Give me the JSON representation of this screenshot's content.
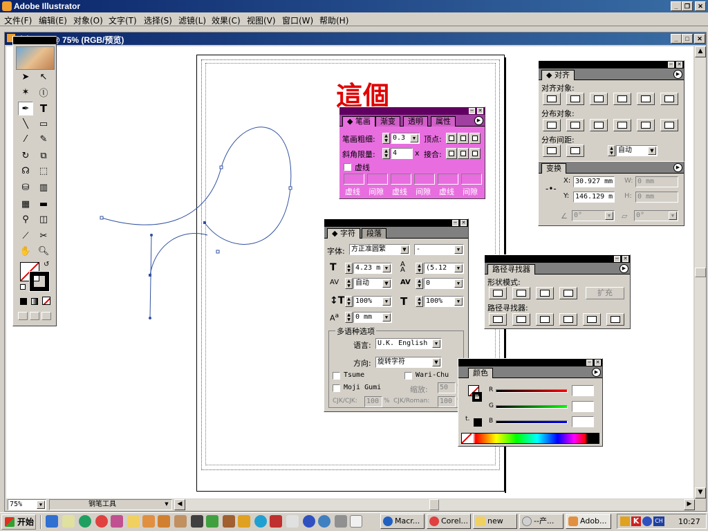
{
  "app": {
    "title": "Adobe Illustrator"
  },
  "menu": [
    "文件(F)",
    "编辑(E)",
    "对象(O)",
    "文字(T)",
    "选择(S)",
    "滤镜(L)",
    "效果(C)",
    "视图(V)",
    "窗口(W)",
    "帮助(H)"
  ],
  "document": {
    "title": "未标题-1 @ 75% (RGB/预览)"
  },
  "annotation": {
    "text": "這個",
    "color": "#e00000"
  },
  "stroke_panel": {
    "tabs": [
      "笔画",
      "渐变",
      "透明",
      "属性"
    ],
    "weight_label": "笔画粗细:",
    "weight_value": "0.3",
    "cap_label": "顶点:",
    "miter_label": "斜角限量:",
    "miter_value": "4",
    "miter_x": "x",
    "join_label": "接合:",
    "dashed_label": "虚线",
    "dash_labels": [
      "虚线",
      "间隙",
      "虚线",
      "间隙",
      "虚线",
      "间隙"
    ],
    "accent": "#e86ee0"
  },
  "character_panel": {
    "tabs": [
      "字符",
      "段落"
    ],
    "font_label": "字体:",
    "font_value": "方正准圆繁",
    "style_value": "-",
    "size_value": "4.23 m",
    "leading_value": "(5.12",
    "kerning_value": "自动",
    "tracking_value": "0",
    "vscale_value": "100%",
    "hscale_value": "100%",
    "baseline_value": "0 mm",
    "multilang_title": "多语种选项",
    "language_label": "语言:",
    "language_value": "U.K. English",
    "direction_label": "方向:",
    "direction_value": "旋转字符",
    "tsume": "Tsume",
    "wari_chu": "Wari-Chu",
    "moji_gumi": "Moji Gumi",
    "scale_label": "缩放:",
    "scale_value": "50",
    "percent": "%",
    "cjk_cjk": "CJK/CJK:",
    "cjk_cjk_value": "100",
    "cjk_roman": "CJK/Roman:",
    "cjk_roman_value": "100"
  },
  "align_panel": {
    "tab": "对齐",
    "align_objects": "对齐对象:",
    "distribute_objects": "分布对象:",
    "distribute_spacing": "分布间距:",
    "spacing_value": "自动"
  },
  "transform_panel": {
    "tab": "变换",
    "x_label": "X:",
    "x_value": "30.927 mm",
    "y_label": "Y:",
    "y_value": "146.129 m",
    "w_label": "W:",
    "w_value": "0 mm",
    "h_label": "H:",
    "h_value": "0 mm",
    "rotate_value": "0°",
    "shear_value": "0°"
  },
  "pathfinder_panel": {
    "tab": "路径寻找器",
    "shape_modes": "形状模式:",
    "expand": "扩充",
    "pathfinders": "路径寻找器:"
  },
  "color_panel": {
    "tab": "颜色",
    "r": "R",
    "g": "G",
    "b": "B"
  },
  "status": {
    "zoom": "75%",
    "tool": "钢笔工具"
  },
  "taskbar": {
    "start": "开始",
    "buttons": [
      "Macr...",
      "Corel...",
      "new",
      "--产...",
      "Adob..."
    ],
    "clock": "10:27"
  }
}
